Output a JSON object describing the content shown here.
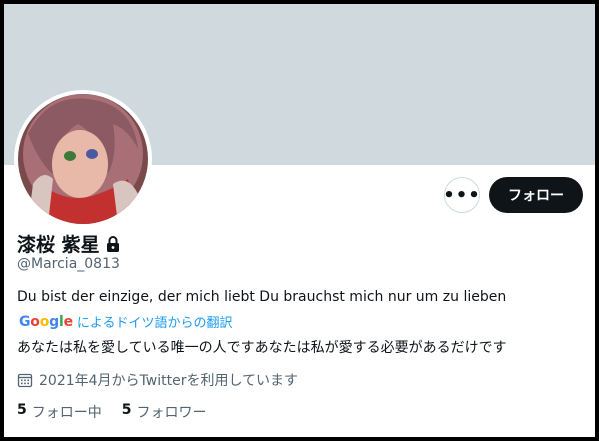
{
  "profile": {
    "display_name": "漆桜 紫星",
    "handle": "@Marcia_0813",
    "bio": "Du bist der einzige, der mich liebt Du brauchst mich nur um zu lieben",
    "translate_label": "によるドイツ語からの翻訳",
    "google_letters": [
      "G",
      "o",
      "o",
      "g",
      "l",
      "e"
    ],
    "translated_bio": "あなたは私を愛している唯一の人ですあなたは私が愛する必要があるだけです",
    "joined": "2021年4月からTwitterを利用しています",
    "following_count": "5",
    "following_label": "フォロー中",
    "followers_count": "5",
    "followers_label": "フォロワー"
  },
  "actions": {
    "more_label": "•••",
    "follow_label": "フォロー"
  },
  "colors": {
    "banner": "#cfd9de",
    "link": "#1d9bf0",
    "secondary_text": "#536471",
    "primary_text": "#0f1419",
    "google_blue": "#4285f4",
    "google_red": "#ea4335",
    "google_yellow": "#fbbc05",
    "google_green": "#34a853"
  },
  "icons": {
    "lock": "lock-icon",
    "calendar": "calendar-icon",
    "more": "more-icon"
  }
}
